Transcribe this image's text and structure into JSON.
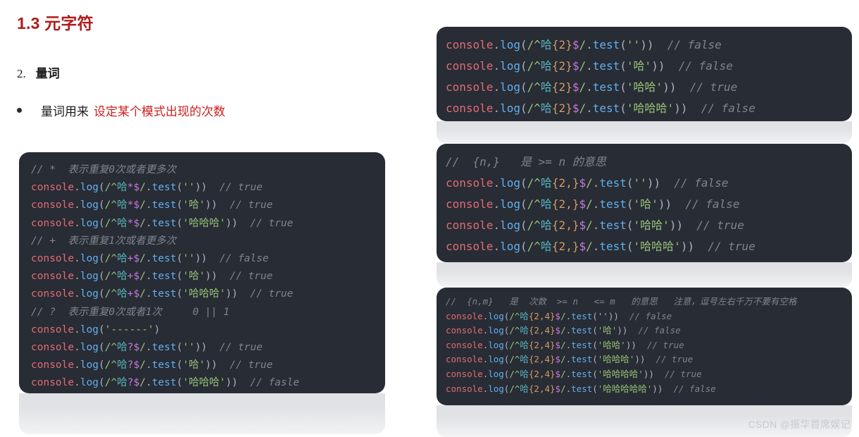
{
  "document": {
    "title": "1.3 元字符",
    "section_number": "2.",
    "section_heading": "量词",
    "bullet_prefix": "量词用来",
    "bullet_highlight": "设定某个模式出现的次数"
  },
  "watermark": "CSDN @振华首席娱记",
  "code_blocks": {
    "left": {
      "name": "star-plus-question-quantifiers",
      "lines": [
        "// *  表示重复0次或者更多次",
        "console.log(/^哈*$/.test(''))  // true",
        "console.log(/^哈*$/.test('哈'))  // true",
        "console.log(/^哈*$/.test('哈哈哈'))  // true",
        "// +  表示重复1次或者更多次",
        "console.log(/^哈+$/.test(''))  // false",
        "console.log(/^哈+$/.test('哈'))  // true",
        "console.log(/^哈+$/.test('哈哈哈'))  // true",
        "// ?  表示重复0次或者1次     0 || 1",
        "console.log('------')",
        "console.log(/^哈?$/.test(''))  // true",
        "console.log(/^哈?$/.test('哈'))  // true",
        "console.log(/^哈?$/.test('哈哈哈'))  // fasle"
      ]
    },
    "top_right": {
      "name": "exact-n-quantifier",
      "lines": [
        "console.log(/^哈{2}$/.test(''))  // false",
        "console.log(/^哈{2}$/.test('哈'))  // false",
        "console.log(/^哈{2}$/.test('哈哈'))  // true",
        "console.log(/^哈{2}$/.test('哈哈哈'))  // false"
      ]
    },
    "middle_right": {
      "name": "n-or-more-quantifier",
      "lines": [
        "//  {n,}   是 >= n 的意思",
        "console.log(/^哈{2,}$/.test(''))  // false",
        "console.log(/^哈{2,}$/.test('哈'))  // false",
        "console.log(/^哈{2,}$/.test('哈哈'))  // true",
        "console.log(/^哈{2,}$/.test('哈哈哈'))  // true"
      ]
    },
    "bottom_right": {
      "name": "n-to-m-quantifier",
      "lines": [
        "//  {n,m}   是  次数  >= n   <= m   的意思   注意，逗号左右千万不要有空格",
        "console.log(/^哈{2,4}$/.test(''))  // false",
        "console.log(/^哈{2,4}$/.test('哈'))  // false",
        "console.log(/^哈{2,4}$/.test('哈哈'))  // true",
        "console.log(/^哈{2,4}$/.test('哈哈哈'))  // true",
        "console.log(/^哈{2,4}$/.test('哈哈哈哈'))  // true",
        "console.log(/^哈{2,4}$/.test('哈哈哈哈哈'))  // false"
      ]
    }
  },
  "colors": {
    "heading_red": "#b01b1b",
    "highlight_red": "#cc1f1f",
    "code_background": "#282c34",
    "token_object": "#e06c75",
    "token_function": "#61afef",
    "token_regex": "#98c379",
    "token_han": "#56b6c2",
    "token_quantifier": "#c678dd",
    "token_brace": "#d19a66",
    "token_string": "#98c379",
    "token_comment": "#7f848e",
    "watermark": "#c9cacd"
  }
}
